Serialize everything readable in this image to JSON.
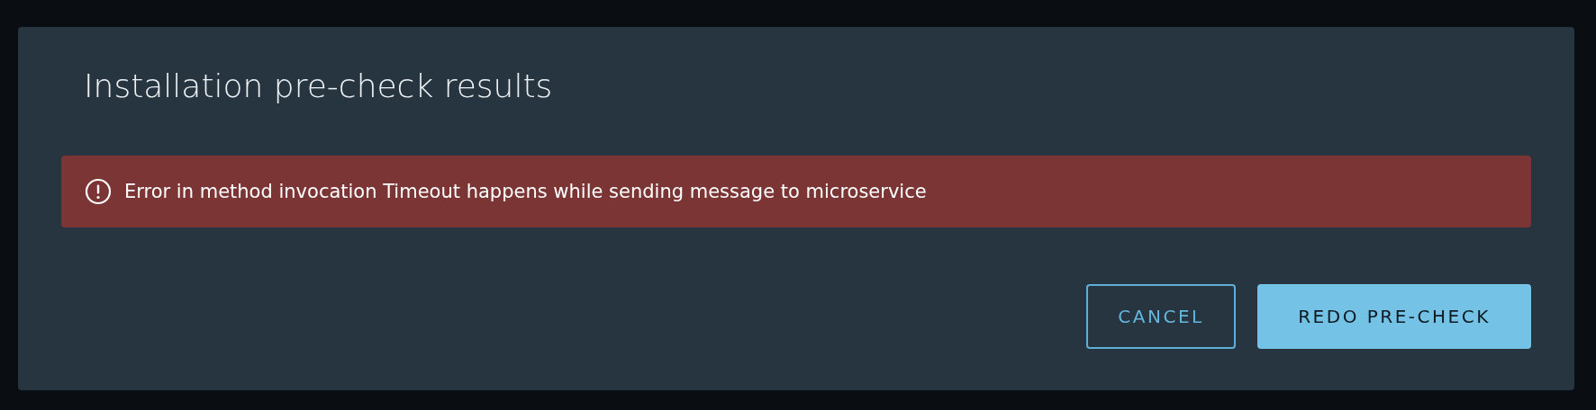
{
  "dialog": {
    "title": "Installation pre-check results",
    "alert": {
      "kind": "error",
      "message": "Error in method invocation Timeout happens while sending message to microservice"
    },
    "buttons": [
      {
        "label": "CANCEL",
        "kind": "outline"
      },
      {
        "label": "REDO PRE-CHECK",
        "kind": "primary"
      }
    ]
  }
}
